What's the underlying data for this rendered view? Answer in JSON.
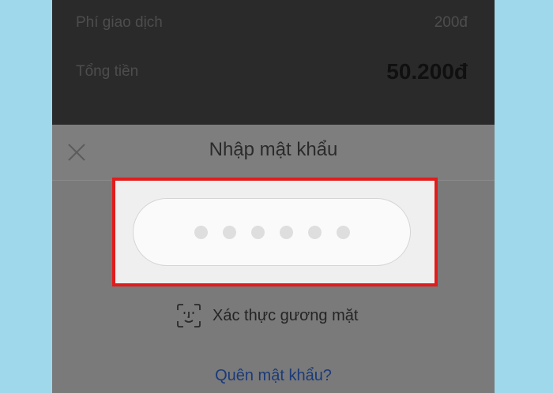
{
  "summary": {
    "fee_label": "Phí giao dịch",
    "fee_value": "200đ",
    "total_label": "Tổng tiền",
    "total_value": "50.200đ"
  },
  "dialog": {
    "title": "Nhập mật khẩu",
    "close_icon": "close-icon",
    "pin_length": 6,
    "face_icon": "face-id-icon",
    "face_auth_label": "Xác thực gương mặt",
    "forgot_password_label": "Quên mật khẩu?"
  },
  "colors": {
    "background": "#9ed8ea",
    "highlight_border": "#e21c1c",
    "link": "#1a3a7a"
  }
}
